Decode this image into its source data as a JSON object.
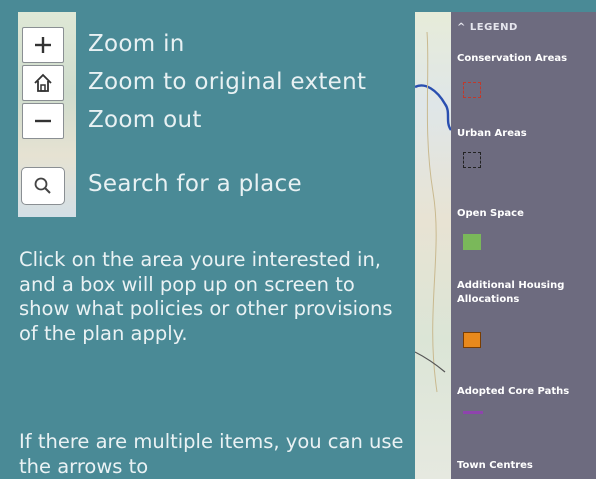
{
  "help": {
    "zoom_in": "Zoom in",
    "zoom_extent": "Zoom to original extent",
    "zoom_out": "Zoom out",
    "search": "Search for a place",
    "paragraph1": "Click on the area youre interested in, and a box will pop up on screen to show what policies or other provisions of the plan apply.",
    "paragraph2": "If there are multiple items, you can use the arrows to"
  },
  "legend": {
    "title": "LEGEND",
    "items": [
      {
        "label": "Conservation Areas",
        "color": "#c0392b"
      },
      {
        "label": "Urban Areas",
        "color": "#222222"
      },
      {
        "label": "Open Space",
        "color": "#7ab85a"
      },
      {
        "label": "Additional Housing Allocations",
        "color": "#e8891c"
      },
      {
        "label": "Adopted Core Paths",
        "color": "#8e44ad"
      },
      {
        "label": "Town Centres",
        "color": "#333333"
      }
    ]
  },
  "icons": {
    "zoom_in": "plus-icon",
    "home": "home-icon",
    "zoom_out": "minus-icon",
    "search": "magnifier-icon",
    "legend_toggle": "chevron-up-icon"
  }
}
